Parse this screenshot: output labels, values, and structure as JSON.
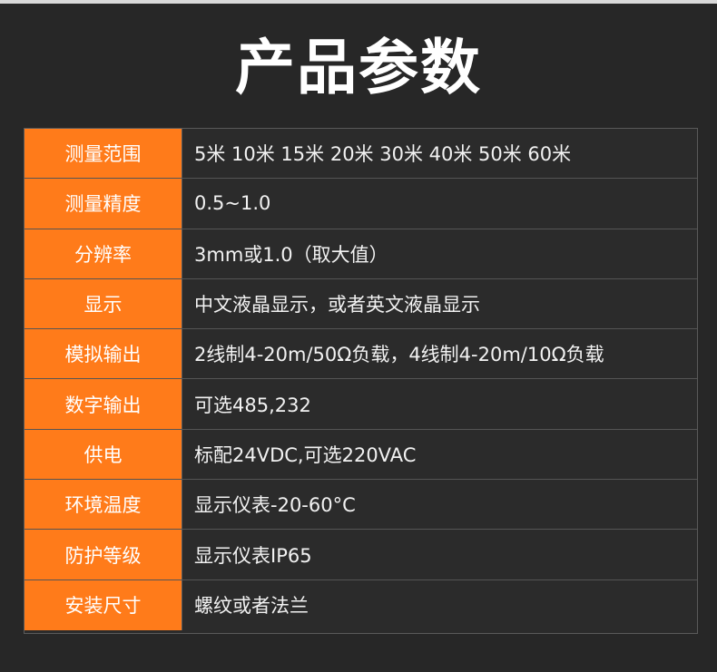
{
  "title": "产品参数",
  "colors": {
    "background": "#272727",
    "label_background": "#ff7b1a",
    "text": "#ffffff"
  },
  "rows": [
    {
      "label": "测量范围",
      "value": "5米   10米   15米   20米   30米   40米    50米   60米"
    },
    {
      "label": "测量精度",
      "value": "0.5~1.0"
    },
    {
      "label": "分辨率",
      "value": "3mm或1.0（取大值）"
    },
    {
      "label": "显示",
      "value": "中文液晶显示，或者英文液晶显示"
    },
    {
      "label": "模拟输出",
      "value": "2线制4-20m/50Ω负载，4线制4-20m/10Ω负载"
    },
    {
      "label": "数字输出",
      "value": "可选485,232"
    },
    {
      "label": "供电",
      "value": "标配24VDC,可选220VAC"
    },
    {
      "label": "环境温度",
      "value": "显示仪表-20-60°C"
    },
    {
      "label": "防护等级",
      "value": "显示仪表IP65"
    },
    {
      "label": "安装尺寸",
      "value": "螺纹或者法兰"
    }
  ]
}
